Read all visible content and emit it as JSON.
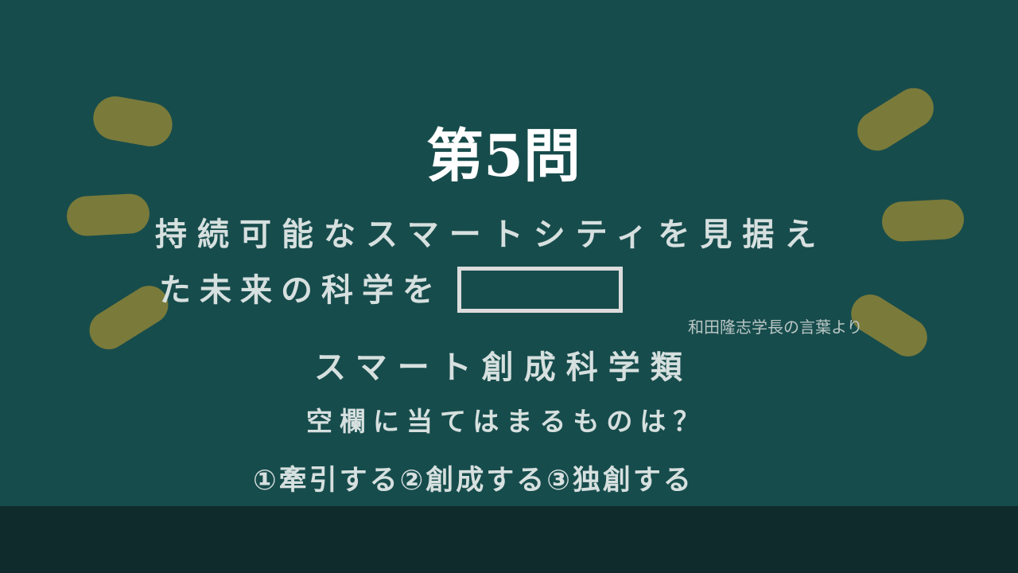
{
  "slide": {
    "title": "第5問",
    "question_line1": "持続可能なスマートシティを見据え",
    "question_line2": "た未来の科学を",
    "attribution": "和田隆志学長の言葉より",
    "department": "スマート創成科学類",
    "prompt": "空欄に当てはまるものは？",
    "options": "①牽引する②創成する③独創する"
  },
  "colors": {
    "background": "#174c4c",
    "band": "#0f2b2b",
    "accent_blob": "#7a7a3a",
    "text": "#d6e0df"
  }
}
